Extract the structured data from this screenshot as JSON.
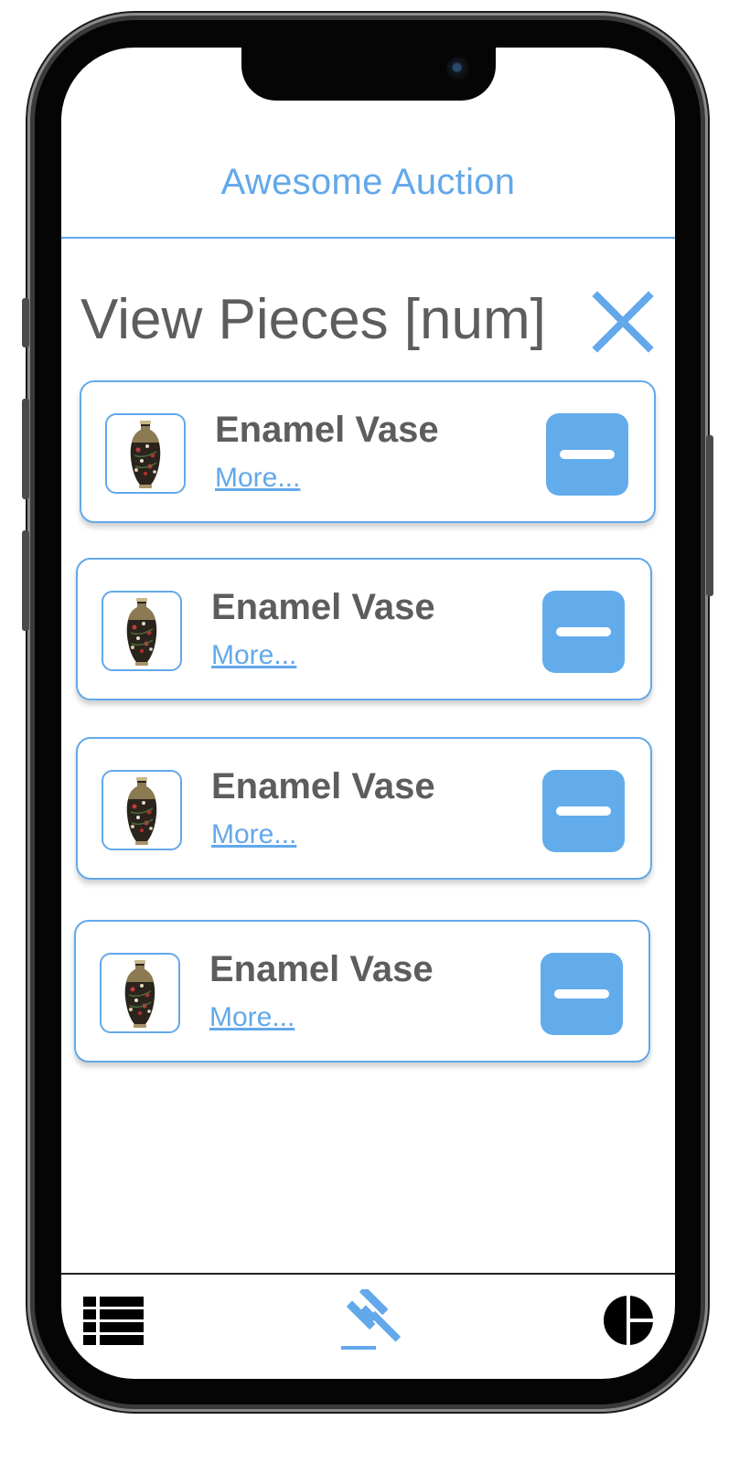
{
  "header": {
    "app_title": "Awesome Auction"
  },
  "page": {
    "title": "View Pieces [num]"
  },
  "pieces": [
    {
      "name": "Enamel Vase",
      "more_label": "More..."
    },
    {
      "name": "Enamel Vase",
      "more_label": "More..."
    },
    {
      "name": "Enamel Vase",
      "more_label": "More..."
    },
    {
      "name": "Enamel Vase",
      "more_label": "More..."
    }
  ],
  "icons": {
    "close": "close-icon",
    "remove": "minus-icon",
    "nav_left": "list-icon",
    "nav_center": "gavel-icon",
    "nav_right": "pie-chart-icon"
  },
  "colors": {
    "accent": "#63a8ea",
    "text": "#5d5d5d",
    "button": "#63acec",
    "nav_icon": "#000000"
  }
}
